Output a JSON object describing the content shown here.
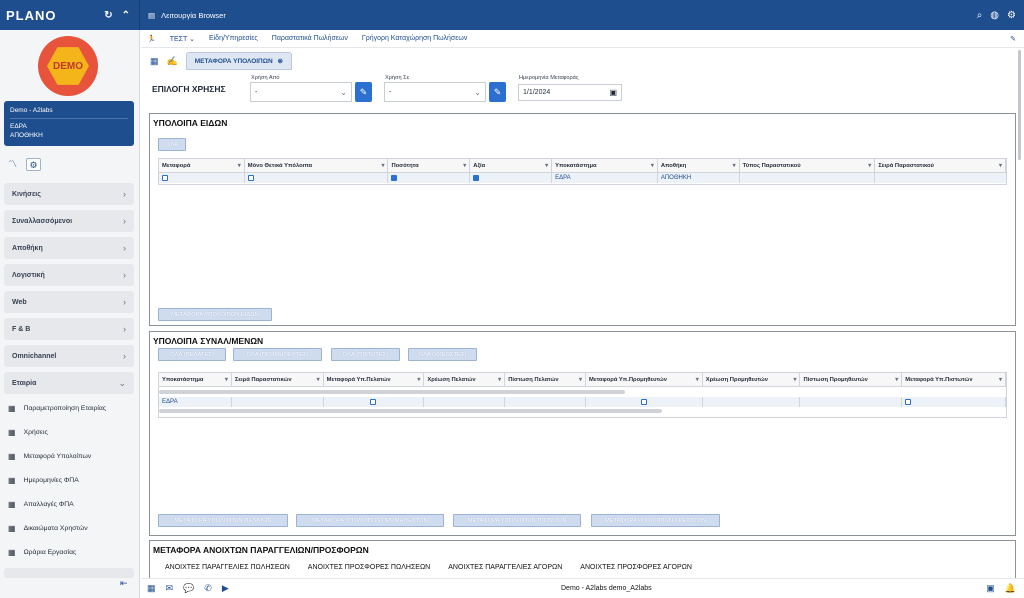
{
  "app": {
    "logo": "PLANO",
    "window_title": "Λειτουργία Browser"
  },
  "sidebar": {
    "logo_text": "DEMO",
    "company": {
      "name": "Demo - A2labs",
      "branch": "ΕΔΡΑ",
      "warehouse": "ΑΠΟΘΗΚΗ"
    },
    "nav": [
      {
        "label": "Κινήσεις"
      },
      {
        "label": "Συναλλασσόμενοι"
      },
      {
        "label": "Αποθήκη"
      },
      {
        "label": "Λογιστική"
      },
      {
        "label": "Web"
      },
      {
        "label": "F & B"
      },
      {
        "label": "Omnichannel"
      },
      {
        "label": "Εταιρία"
      }
    ],
    "subitems": [
      {
        "label": "Παραμετροποίηση Εταιρίας"
      },
      {
        "label": "Χρήσεις"
      },
      {
        "label": "Μεταφορά Υπολοίπων"
      },
      {
        "label": "Ημερομηνίες ΦΠΑ"
      },
      {
        "label": "Απαλλαγές ΦΠΑ"
      },
      {
        "label": "Δικαιώματα Χρηστών"
      },
      {
        "label": "Ωράρια Εργασίας"
      }
    ]
  },
  "menubar": {
    "items": [
      "ΤΕΣΤ",
      "Είδη/Υπηρεσίες",
      "Παραστατικά Πωλήσεων",
      "Γρήγορη Καταχώρηση Πωλήσεων"
    ]
  },
  "tab": {
    "label": "ΜΕΤΑΦΟΡΑ ΥΠΟΛΟΙΠΩΝ"
  },
  "filters": {
    "title": "ΕΠΙΛΟΓΗ ΧΡΗΣΗΣ",
    "from_label": "Χρήση Από",
    "from_value": "-",
    "to_label": "Χρήση Σε",
    "to_value": "-",
    "date_label": "Ημερομηνία Μεταφοράς",
    "date_value": "1/1/2024"
  },
  "items_panel": {
    "title": "ΥΠΟΛΟΙΠΑ ΕΙΔΩΝ",
    "all_button": "ΟΛΑ",
    "columns": [
      "Μεταφορά",
      "Μόνο Θετικά Υπόλοιπα",
      "Ποσότητα",
      "Αξία",
      "Υποκατάστημα",
      "Αποθήκη",
      "Τύπος Παραστατικού",
      "Σειρά Παραστατικού"
    ],
    "row": {
      "branch": "ΕΔΡΑ",
      "warehouse": "ΑΠΟΘΗΚΗ"
    },
    "transfer_button": "ΜΕΤΑΦΟΡΑ ΥΠΟΛΟΙΠΩΝ ΕΙΔΩΝ"
  },
  "partners_panel": {
    "title": "ΥΠΟΛΟΙΠΑ ΣΥΝΑΛ/ΜΕΝΩΝ",
    "filter_buttons": [
      "ΟΛΑ (ΠΕΛΑΤΕΣ)",
      "ΟΛΑ (ΠΡΟΜΗΘΕΥΤΕΣ)",
      "ΟΛΑ (ΠΙΣΤΩΤΕΣ)",
      "ΟΛΑ (ΧΡΕΩΣΤΕΣ)"
    ],
    "columns": [
      "Υποκατάστημα",
      "Σειρά Παραστατικών",
      "Μεταφορά Υπ.Πελατών",
      "Χρέωση Πελατών",
      "Πίστωση Πελατών",
      "Μεταφορά Υπ.Προμηθευτών",
      "Χρέωση Προμηθευτών",
      "Πίστωση Προμηθευτών",
      "Μεταφορά Υπ.Πιστωτών"
    ],
    "row": {
      "branch": "ΕΔΡΑ"
    },
    "transfer_buttons": [
      "ΜΕΤΑΦΟΡΑ ΥΠΟΛΟΙΠΩΝ ΠΕΛΑΤΩΝ",
      "ΜΕΤΑΦΟΡΑ ΥΠΟΛΟΙΠΩΝ ΠΡΟΜΗΘΕΥΤΩΝ",
      "ΜΕΤΑΦΟΡΑ ΥΠΟΛΟΙΠΩΝ ΠΙΣΤΩΤΩΝ",
      "ΜΕΤΑΦΟΡΑ ΥΠΟΛΟΙΠΩΝ ΧΡΕΩΣΤΩΝ"
    ]
  },
  "orders_panel": {
    "title": "ΜΕΤΑΦΟΡΑ ΑΝΟΙΧΤΩΝ ΠΑΡΑΓΓΕΛΙΩΝ/ΠΡΟΣΦΟΡΩΝ",
    "links": [
      "ΑΝΟΙΧΤΕΣ ΠΑΡΑΓΓΕΛΙΕΣ ΠΩΛΗΣΕΩΝ",
      "ΑΝΟΙΧΤΕΣ ΠΡΟΣΦΟΡΕΣ ΠΩΛΗΣΕΩΝ",
      "ΑΝΟΙΧΤΕΣ ΠΑΡΑΓΓΕΛΙΕΣ ΑΓΟΡΩΝ",
      "ΑΝΟΙΧΤΕΣ ΠΡΟΣΦΟΡΕΣ ΑΓΟΡΩΝ"
    ]
  },
  "footer": {
    "user": "Demo - A2labs demo_A2labs"
  },
  "colors": {
    "brand": "#1f4e8f",
    "accent": "#2b6fd0"
  }
}
